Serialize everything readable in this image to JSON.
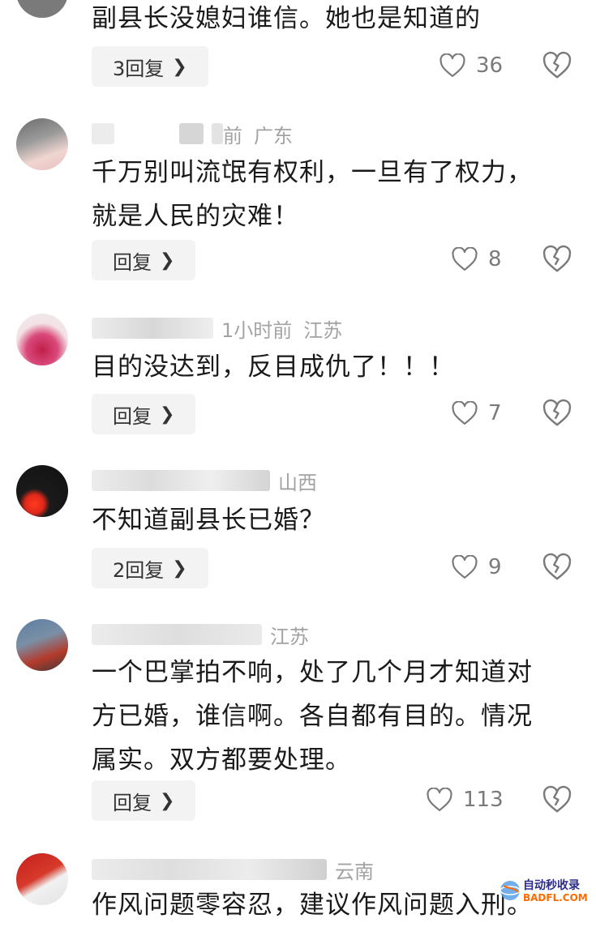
{
  "comments": [
    {
      "meta": {
        "time": "",
        "location": ""
      },
      "text": "副县长没媳妇谁信。她也是知道的",
      "reply_label": "3回复",
      "likes": "36"
    },
    {
      "meta": {
        "time": "前",
        "location": "广东"
      },
      "text": "千万别叫流氓有权利，一旦有了权力，\n就是人民的灾难！",
      "reply_label": "回复",
      "likes": "8"
    },
    {
      "meta": {
        "time": "1小时前",
        "location": "江苏"
      },
      "text": "目的没达到，反目成仇了！！！",
      "reply_label": "回复",
      "likes": "7"
    },
    {
      "meta": {
        "time": "",
        "location": "山西"
      },
      "text": "不知道副县长已婚？",
      "reply_label": "2回复",
      "likes": "9"
    },
    {
      "meta": {
        "time": "",
        "location": "江苏"
      },
      "text": "一个巴掌拍不响，处了几个月才知道对\n方已婚，谁信啊。各自都有目的。情况\n属实。双方都要处理。",
      "reply_label": "回复",
      "likes": "113"
    },
    {
      "meta": {
        "time": "",
        "location": "云南"
      },
      "text": "作风问题零容忍，建议作风问题入刑。",
      "reply_label": "",
      "likes": ""
    }
  ],
  "watermark": {
    "line1": "自动秒收录",
    "line2": "BADFL.COM"
  },
  "icons": {
    "like": "heart-outline-icon",
    "dislike": "broken-heart-icon",
    "reply_arrow": "chevron-right-icon"
  }
}
